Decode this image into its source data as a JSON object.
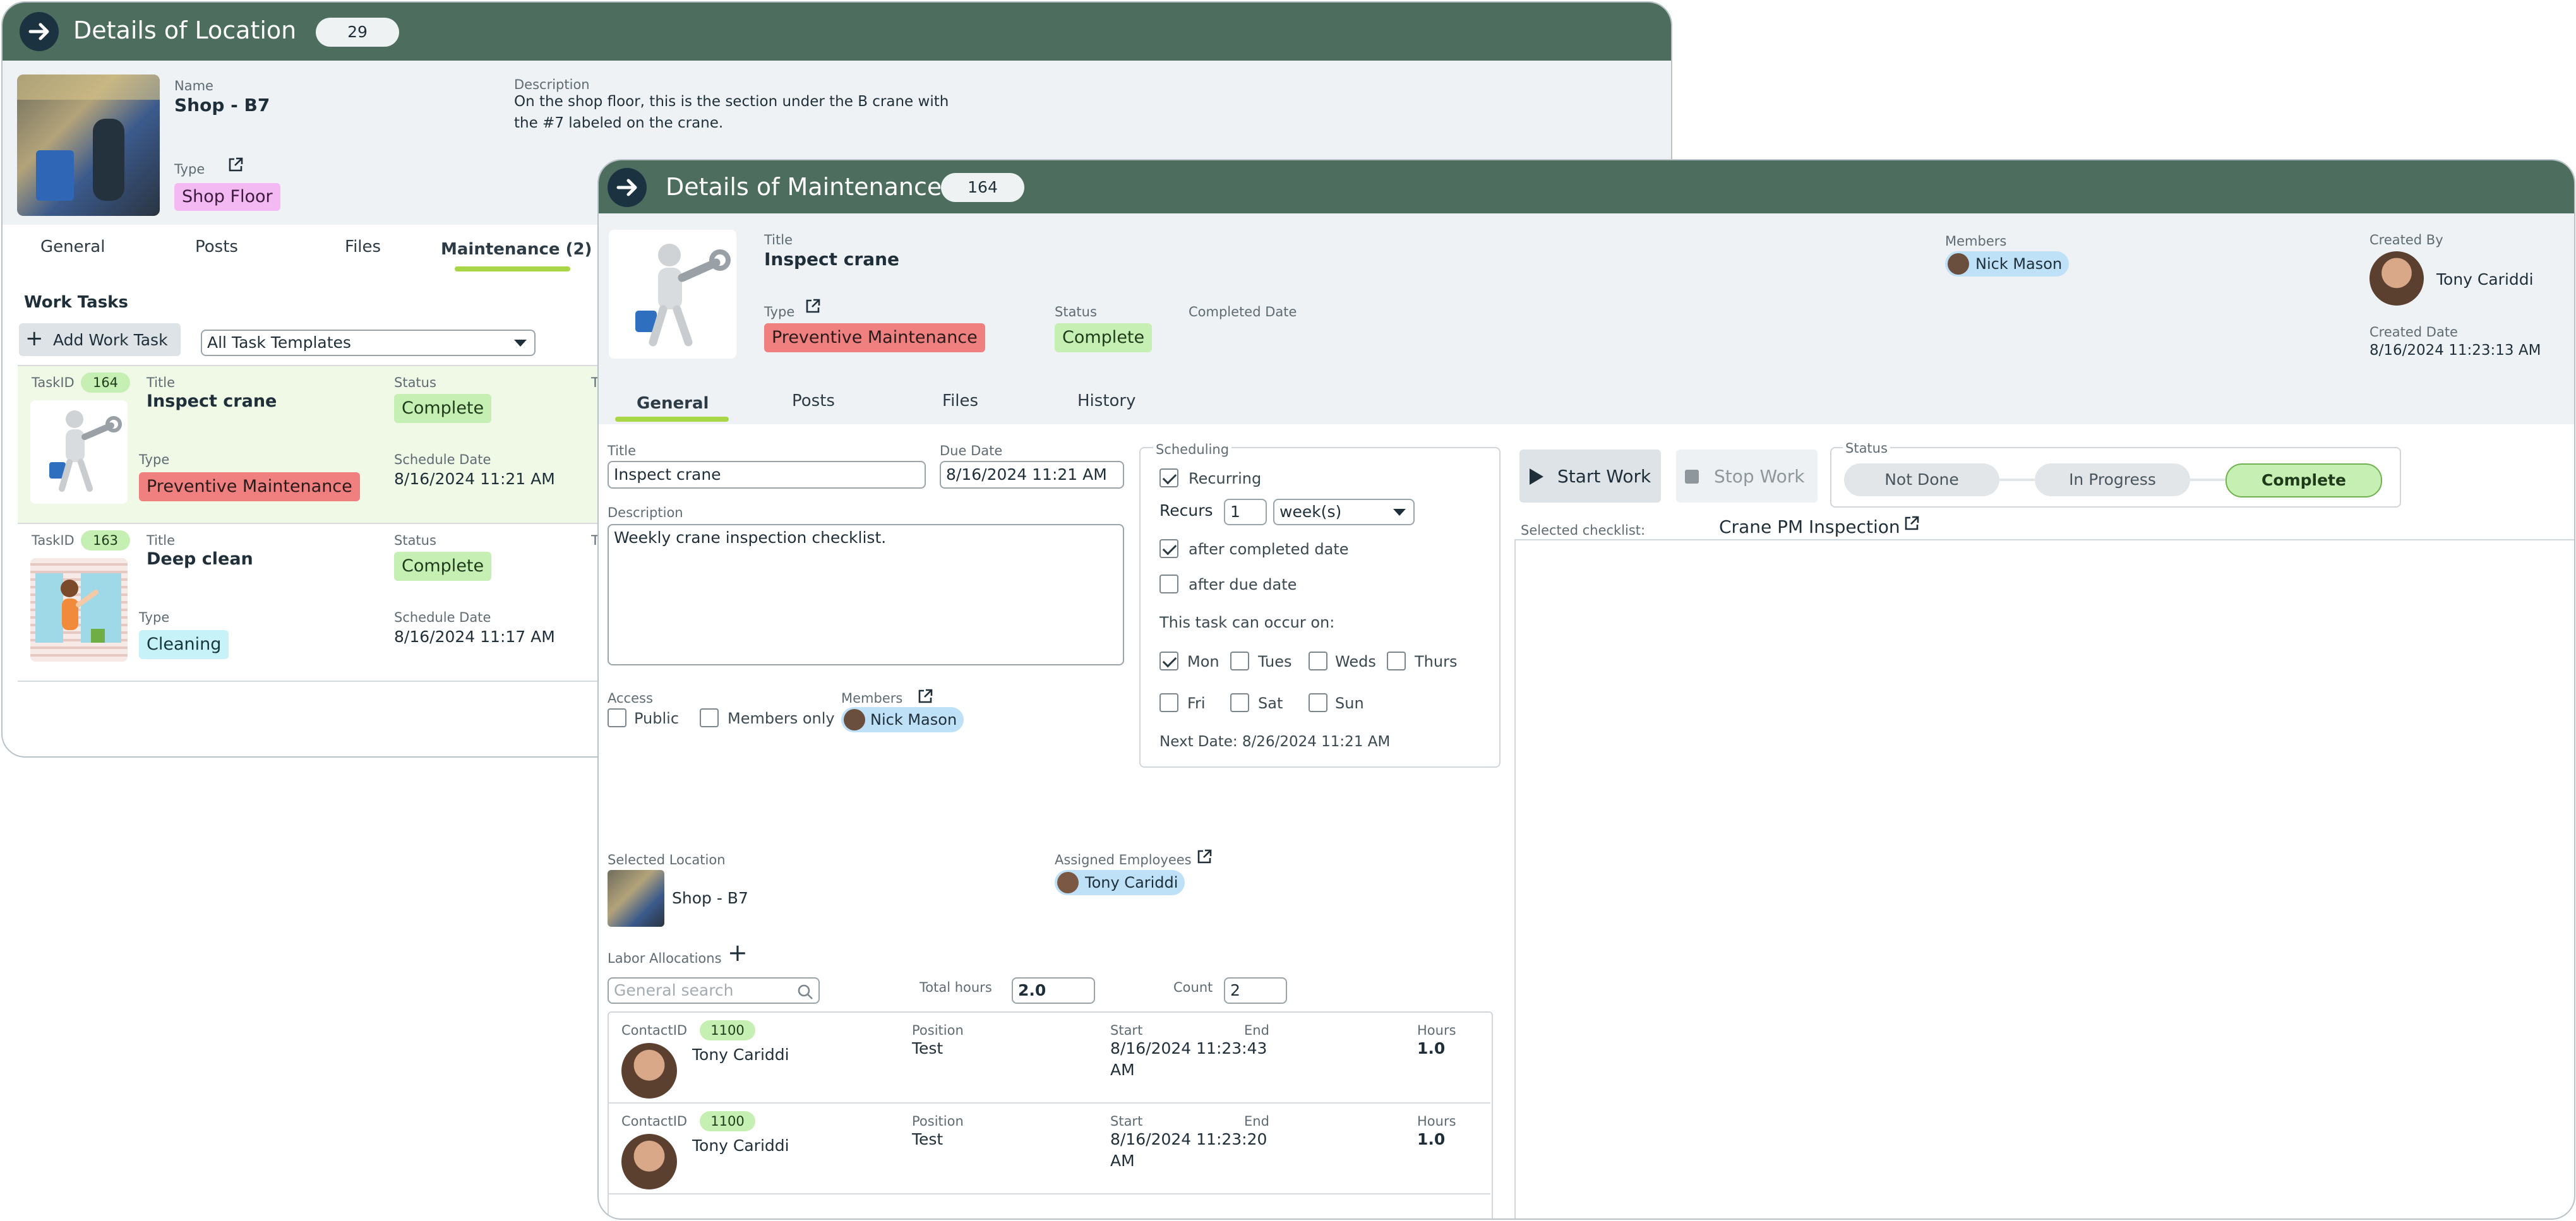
{
  "location": {
    "title": "Details of Location",
    "count": "29",
    "name_label": "Name",
    "name": "Shop - B7",
    "description_label": "Description",
    "description_line1": "On the shop floor, this is the section under the B crane with",
    "description_line2": "the #7 labeled on the crane.",
    "type_label": "Type",
    "type": "Shop Floor",
    "tabs": [
      "General",
      "Posts",
      "Files",
      "Maintenance (2)"
    ],
    "work_tasks_label": "Work Tasks",
    "add_work_task": "Add Work Task",
    "template_select": "All Task Templates",
    "tasks": [
      {
        "taskid_label": "TaskID",
        "taskid": "164",
        "title_label": "Title",
        "title": "Inspect crane",
        "type_label": "Type",
        "type": "Preventive Maintenance",
        "status_label": "Status",
        "status": "Complete",
        "schedule_label": "Schedule Date",
        "schedule": "8/16/2024 11:21 AM",
        "extra_label": "T"
      },
      {
        "taskid_label": "TaskID",
        "taskid": "163",
        "title_label": "Title",
        "title": "Deep clean",
        "type_label": "Type",
        "type": "Cleaning",
        "status_label": "Status",
        "status": "Complete",
        "schedule_label": "Schedule Date",
        "schedule": "8/16/2024 11:17 AM",
        "extra_label": "T"
      }
    ]
  },
  "maintenance": {
    "title": "Details of Maintenance",
    "count": "164",
    "title_label": "Title",
    "task_title": "Inspect crane",
    "type_label": "Type",
    "type": "Preventive Maintenance",
    "status_label": "Status",
    "status": "Complete",
    "completed_date_label": "Completed Date",
    "members_label": "Members",
    "member": "Nick Mason",
    "created_by_label": "Created By",
    "created_by": "Tony Cariddi",
    "created_date_label": "Created Date",
    "created_date": "8/16/2024 11:23:13 AM",
    "tabs": [
      "General",
      "Posts",
      "Files",
      "History"
    ],
    "form": {
      "title_label": "Title",
      "title_value": "Inspect crane",
      "due_label": "Due Date",
      "due_value": "8/16/2024 11:21 AM",
      "description_label": "Description",
      "description_value": "Weekly crane inspection checklist.",
      "access_label": "Access",
      "public_label": "Public",
      "members_only_label": "Members only",
      "members_label": "Members",
      "member_chip": "Nick Mason"
    },
    "scheduling": {
      "label": "Scheduling",
      "recurring_label": "Recurring",
      "recurs_label": "Recurs",
      "recurs_value": "1",
      "period": "week(s)",
      "after_completed": "after completed date",
      "after_due": "after due date",
      "occur_label": "This task can occur on:",
      "days": [
        "Mon",
        "Tues",
        "Weds",
        "Thurs",
        "Fri",
        "Sat",
        "Sun"
      ],
      "next_date": "Next Date: 8/26/2024 11:21 AM"
    },
    "work": {
      "start": "Start Work",
      "stop": "Stop Work",
      "status_label": "Status",
      "steps": [
        "Not Done",
        "In Progress",
        "Complete"
      ],
      "checklist_label": "Selected checklist:",
      "checklist": "Crane PM Inspection"
    },
    "location_label": "Selected Location",
    "location": "Shop - B7",
    "assigned_label": "Assigned Employees",
    "assigned": "Tony Cariddi",
    "labor": {
      "label": "Labor Allocations",
      "search_placeholder": "General search",
      "total_hours_label": "Total hours",
      "total_hours": "2.0",
      "count_label": "Count",
      "count": "2",
      "rows": [
        {
          "contact_label": "ContactID",
          "contact": "1100",
          "name": "Tony Cariddi",
          "position_label": "Position",
          "position": "Test",
          "start_label": "Start",
          "start1": "8/16/2024 11:23:43",
          "start2": "AM",
          "end_label": "End",
          "hours_label": "Hours",
          "hours": "1.0"
        },
        {
          "contact_label": "ContactID",
          "contact": "1100",
          "name": "Tony Cariddi",
          "position_label": "Position",
          "position": "Test",
          "start_label": "Start",
          "start1": "8/16/2024 11:23:20",
          "start2": "AM",
          "end_label": "End",
          "hours_label": "Hours",
          "hours": "1.0"
        }
      ]
    }
  },
  "colors": {
    "header": "#4d6e5f",
    "accent": "#a9d646",
    "complete": "#c6f0b3",
    "preventive": "#f08080"
  }
}
